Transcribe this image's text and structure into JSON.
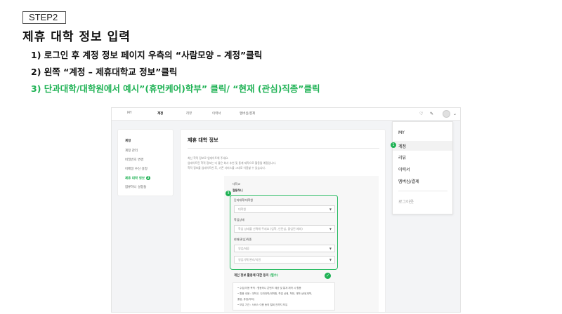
{
  "step_tag": "STEP2",
  "title": "제휴 대학 정보 입력",
  "instructions": [
    "1) 로그인 후 계정 정보 페이지 우측의 “사람모양 – 계정”클릭",
    "2) 왼쪽 “계정 – 제휴대학교 정보”클릭",
    "3) 단과대학/대학원에서 예시”(휴먼케어)학부” 클릭/ “현재 (관심)직종”클릭"
  ],
  "colors": {
    "accent": "#1eb254",
    "box_border": "#2ebd66"
  },
  "screenshot": {
    "nav": [
      "MY",
      "계정",
      "리뷰",
      "이력서",
      "멤버십/결제"
    ],
    "nav_icons": [
      "bell-icon",
      "pencil-icon",
      "avatar-icon",
      "chevron-down-icon"
    ],
    "sidebar": {
      "heading": "계정",
      "items": [
        "계정 관리",
        "비밀번호 변경",
        "이메일 수신 설정",
        "제휴 대학 정보",
        "합류하니 설정들"
      ],
      "active_badge": "2"
    },
    "content": {
      "title": "제휴 대학 정보",
      "desc": [
        "최신 학적 정보로 업데이트해 주세요.",
        "업데이트된 학적 정보는 더 좋은 회사 추천 및 통계 제작으로 활용될 예정입니다.",
        "학적 정보를 업데이트한 후, 기존 서비스를 그대로 이용할 수 있습니다."
      ],
      "school_label": "대학교",
      "school_name": "협동하니",
      "green_badge": "3",
      "fields": [
        {
          "label": "단과대학/대학원",
          "value": "대학원"
        },
        {
          "label": "학업상태",
          "value": "학업 상태를 선택해 주세요 (입학, 인턴십, 졸업된 예외)"
        },
        {
          "label": "현재(관심)직종",
          "value": "영업/제휴"
        },
        {
          "label": "",
          "value": "영업기획/관리/지원"
        }
      ],
      "agree_title": "개인 정보 활용에 대한 동의",
      "agree_required": "(필수)",
      "terms": [
        "• 수집/이용 목적 : 협동하니 콘텐츠 제공 및 통계 제작 시 활용",
        "• 활용 내용 : 대학교, 단과대학/대학원, 학업 상태, 학번, 재학 상태(재학,",
        "  졸업, 휴업/자퇴)",
        "• 보유 기간 : 서비스 이용 동의 철회 전까지 보유"
      ]
    },
    "dropdown": {
      "items": [
        "MY",
        "계정",
        "리뷰",
        "이력서",
        "멤버십/결제"
      ],
      "logout": "로그아웃",
      "badge": "1"
    }
  }
}
